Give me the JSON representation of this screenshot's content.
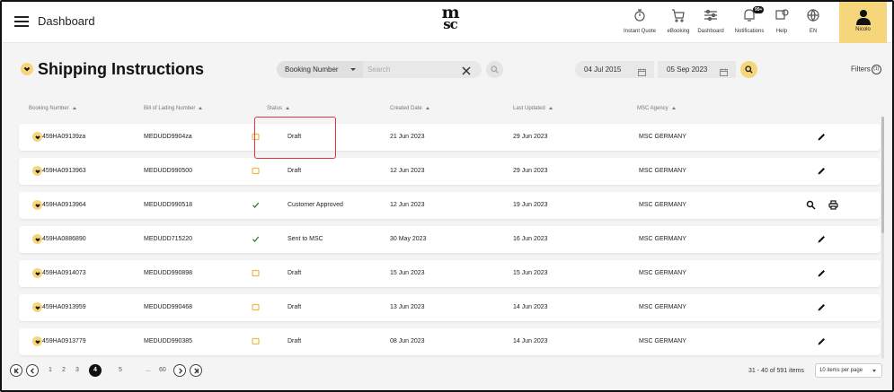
{
  "topbar": {
    "title": "Dashboard",
    "nav": [
      {
        "label": "Instant Quote",
        "icon": "instant-quote-icon"
      },
      {
        "label": "eBooking",
        "icon": "cart-icon"
      },
      {
        "label": "Dashboard",
        "icon": "sliders-icon"
      },
      {
        "label": "Notifications",
        "icon": "bell-icon",
        "badge": "99+"
      },
      {
        "label": "Help",
        "icon": "help-icon"
      },
      {
        "label": "EN",
        "icon": "globe-icon"
      }
    ],
    "user": {
      "name": "Nicolo",
      "icon": "user-icon"
    }
  },
  "header": {
    "title": "Shipping Instructions",
    "search_field": "Booking Number",
    "search_placeholder": "Search",
    "date_from": "04 Jul 2015",
    "date_to": "05 Sep 2023",
    "filters_label": "Filters",
    "filters_count": "(1)"
  },
  "columns": [
    "Booking Number",
    "Bill of Lading Number",
    "Status",
    "Created Date",
    "Last Updated",
    "MSC Agency"
  ],
  "rows": [
    {
      "booking": "459HA09139za",
      "bol": "MEDUDD9904za",
      "status": "Draft",
      "status_type": "draft",
      "created": "21 Jun 2023",
      "updated": "29 Jun 2023",
      "agency": "MSC GERMANY",
      "actions": [
        "edit-icon"
      ]
    },
    {
      "booking": "459HA0913963",
      "bol": "MEDUDD990500",
      "status": "Draft",
      "status_type": "draft",
      "created": "12 Jun 2023",
      "updated": "29 Jun 2023",
      "agency": "MSC GERMANY",
      "actions": [
        "edit-icon"
      ]
    },
    {
      "booking": "459HA0913964",
      "bol": "MEDUDD990518",
      "status": "Customer Approved",
      "status_type": "approved",
      "created": "12 Jun 2023",
      "updated": "19 Jun 2023",
      "agency": "MSC GERMANY",
      "actions": [
        "search-icon",
        "print-icon"
      ]
    },
    {
      "booking": "459HA0886890",
      "bol": "MEDUDD715220",
      "status": "Sent to MSC",
      "status_type": "approved",
      "created": "30 May 2023",
      "updated": "16 Jun 2023",
      "agency": "MSC GERMANY",
      "actions": [
        "edit-icon"
      ]
    },
    {
      "booking": "459HA0914073",
      "bol": "MEDUDD990898",
      "status": "Draft",
      "status_type": "draft",
      "created": "15 Jun 2023",
      "updated": "15 Jun 2023",
      "agency": "MSC GERMANY",
      "actions": [
        "edit-icon"
      ]
    },
    {
      "booking": "459HA0913959",
      "bol": "MEDUDD990468",
      "status": "Draft",
      "status_type": "draft",
      "created": "13 Jun 2023",
      "updated": "14 Jun 2023",
      "agency": "MSC GERMANY",
      "actions": [
        "edit-icon"
      ]
    },
    {
      "booking": "459HA0913779",
      "bol": "MEDUDD990385",
      "status": "Draft",
      "status_type": "draft",
      "created": "08 Jun 2023",
      "updated": "14 Jun 2023",
      "agency": "MSC GERMANY",
      "actions": [
        "edit-icon"
      ]
    }
  ],
  "pagination": {
    "pages": [
      "1",
      "2",
      "3",
      "4",
      "5",
      "...",
      "60"
    ],
    "current": "4",
    "summary": "31 - 40 of 591 items",
    "page_size": "10 items per page"
  },
  "colors": {
    "accent": "#f5d67b",
    "highlight": "#e0343a",
    "draft": "#f0b84a",
    "approved": "#2e7d32"
  }
}
